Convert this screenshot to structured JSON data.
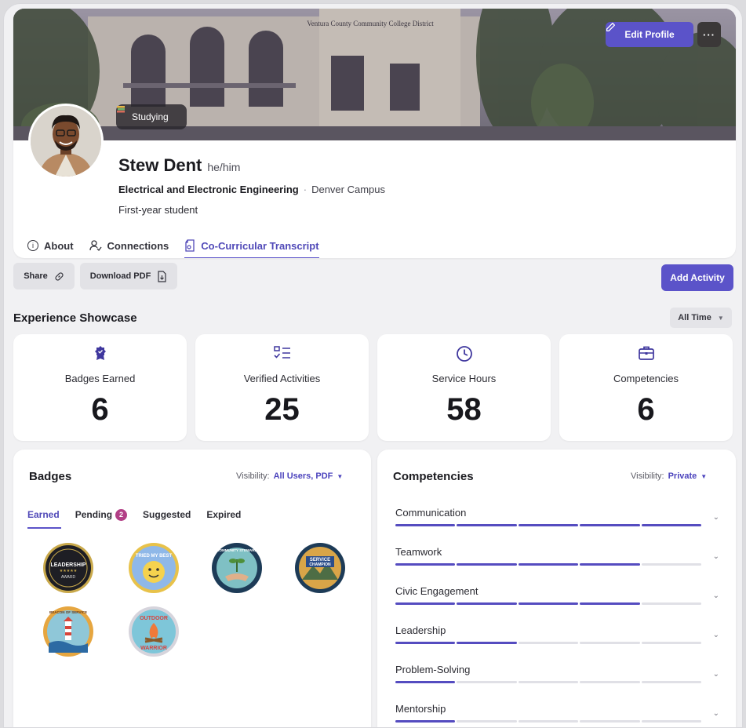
{
  "colors": {
    "accent": "#5b53c9",
    "accent_dark": "#4c44bd",
    "pending_badge": "#b23f86"
  },
  "profile": {
    "edit_label": "Edit Profile",
    "more_label": "···",
    "status": "Studying",
    "name": "Stew Dent",
    "pronouns": "he/him",
    "major": "Electrical and Electronic Engineering",
    "separator": "·",
    "campus": "Denver Campus",
    "year": "First-year student",
    "cover_text": "Ventura County Community College District"
  },
  "tabs": [
    {
      "label": "About",
      "icon": "info-icon"
    },
    {
      "label": "Connections",
      "icon": "connections-icon"
    },
    {
      "label": "Co-Curricular Transcript",
      "icon": "transcript-icon",
      "active": true
    }
  ],
  "actions": {
    "share": "Share",
    "download": "Download PDF",
    "add": "Add Activity"
  },
  "showcase": {
    "title": "Experience Showcase",
    "filter": "All Time",
    "stats": [
      {
        "label": "Badges Earned",
        "value": "6",
        "icon": "badge-icon"
      },
      {
        "label": "Verified Activities",
        "value": "25",
        "icon": "checklist-icon"
      },
      {
        "label": "Service Hours",
        "value": "58",
        "icon": "clock-icon"
      },
      {
        "label": "Competencies",
        "value": "6",
        "icon": "briefcase-icon"
      }
    ]
  },
  "badges": {
    "title": "Badges",
    "visibility_label": "Visibility:",
    "visibility_value": "All Users, PDF",
    "tabs": [
      {
        "label": "Earned",
        "active": true
      },
      {
        "label": "Pending",
        "count": "2"
      },
      {
        "label": "Suggested"
      },
      {
        "label": "Expired"
      }
    ],
    "items": [
      {
        "name": "Leadership Award",
        "text_top": "LEADERSHIP",
        "text_bottom": "AWARD"
      },
      {
        "name": "Tried My Best",
        "text_top": "TRIED MY BEST"
      },
      {
        "name": "Community Steward",
        "text_top": "COMMUNITY STEWARD"
      },
      {
        "name": "Service Champion",
        "text_top": "SERVICE",
        "text_bottom": "CHAMPION"
      },
      {
        "name": "Beacon of Service",
        "text_top": "BEACON OF SERVICE"
      },
      {
        "name": "Outdoor Warrior",
        "text_top": "OUTDOOR",
        "text_bottom": "WARRIOR"
      }
    ]
  },
  "competencies": {
    "title": "Competencies",
    "visibility_label": "Visibility:",
    "visibility_value": "Private",
    "items": [
      {
        "name": "Communication",
        "level": 5
      },
      {
        "name": "Teamwork",
        "level": 4
      },
      {
        "name": "Civic Engagement",
        "level": 4
      },
      {
        "name": "Leadership",
        "level": 2
      },
      {
        "name": "Problem-Solving",
        "level": 1
      },
      {
        "name": "Mentorship",
        "level": 1
      }
    ],
    "max_level": 5
  }
}
